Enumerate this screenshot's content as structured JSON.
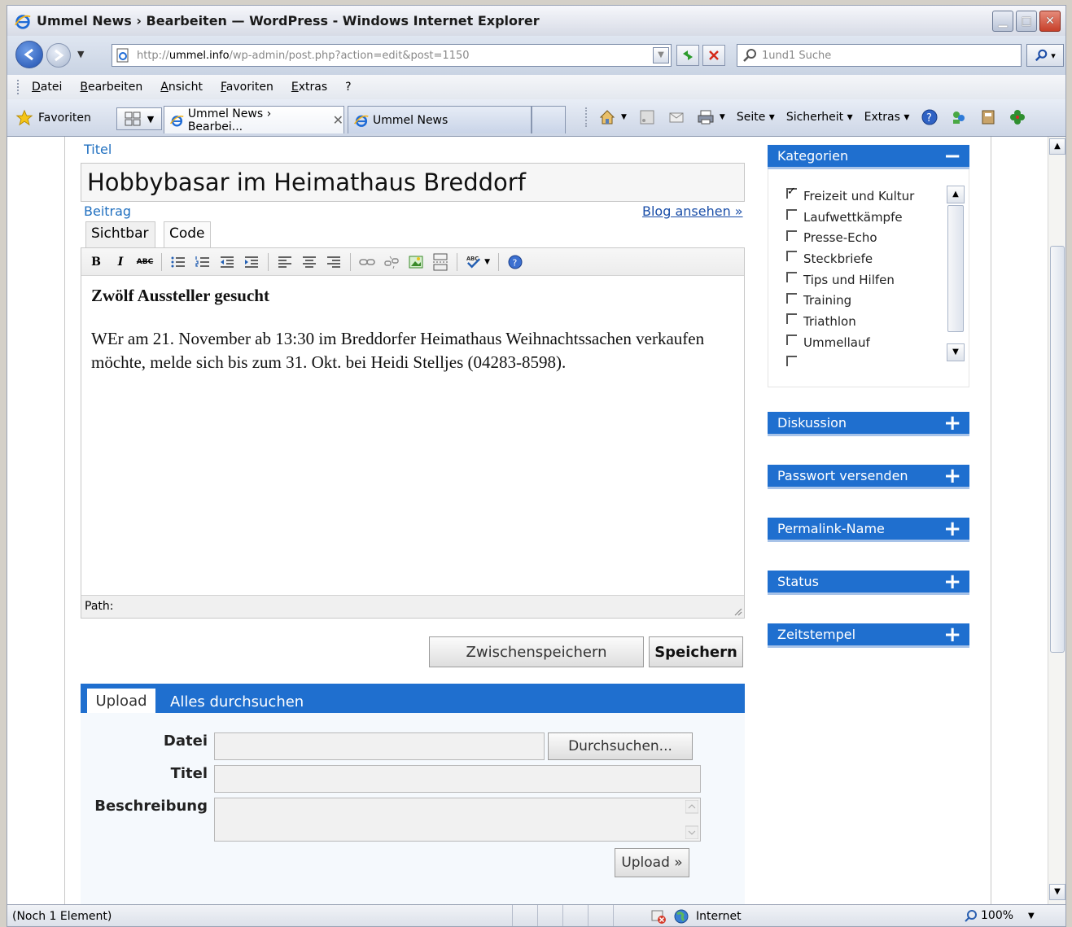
{
  "window": {
    "title": "Ummel News › Bearbeiten — WordPress - Windows Internet Explorer"
  },
  "address": {
    "url_prefix": "http://",
    "url_host": "ummel.info",
    "url_path": "/wp-admin/post.php?action=edit&post=1150",
    "search_placeholder": "1und1 Suche"
  },
  "menu": [
    "Datei",
    "Bearbeiten",
    "Ansicht",
    "Favoriten",
    "Extras",
    "?"
  ],
  "toolbar": {
    "favorites_label": "Favoriten",
    "tabs": [
      {
        "title": "Ummel News › Bearbei...",
        "active": true
      },
      {
        "title": "Ummel News",
        "active": false
      }
    ],
    "commands": {
      "page": "Seite",
      "security": "Sicherheit",
      "extras": "Extras"
    }
  },
  "post": {
    "title_label": "Titel",
    "title_value": "Hobbybasar im Heimathaus Breddorf",
    "content_label": "Beitrag",
    "blog_link": "Blog ansehen »",
    "tab_visual": "Sichtbar",
    "tab_code": "Code",
    "heading": "Zwölf Aussteller gesucht",
    "paragraph": "WEr am 21. November ab 13:30 im Breddorfer Heimathaus Weihnachtssachen verkaufen möchte, melde sich bis zum 31. Okt. bei Heidi Stelljes (04283-8598).",
    "path_label": "Path:",
    "save_draft": "Zwischenspeichern",
    "save": "Speichern"
  },
  "upload": {
    "tab_upload": "Upload",
    "tab_browse_all": "Alles durchsuchen",
    "file_label": "Datei",
    "browse_button": "Durchsuchen...",
    "title_label": "Titel",
    "description_label": "Beschreibung",
    "upload_button": "Upload »"
  },
  "sidebar": {
    "categories_title": "Kategorien",
    "categories": [
      {
        "name": "Freizeit und Kultur",
        "checked": true
      },
      {
        "name": "Laufwettkämpfe",
        "checked": false
      },
      {
        "name": "Presse-Echo",
        "checked": false
      },
      {
        "name": "Steckbriefe",
        "checked": false
      },
      {
        "name": "Tips und Hilfen",
        "checked": false
      },
      {
        "name": "Training",
        "checked": false
      },
      {
        "name": "Triathlon",
        "checked": false
      },
      {
        "name": "Ummellauf",
        "checked": false
      }
    ],
    "boxes": [
      "Diskussion",
      "Passwort versenden",
      "Permalink-Name",
      "Status",
      "Zeitstempel"
    ]
  },
  "status": {
    "text": "(Noch 1 Element)",
    "zone": "Internet",
    "zoom": "100%"
  }
}
